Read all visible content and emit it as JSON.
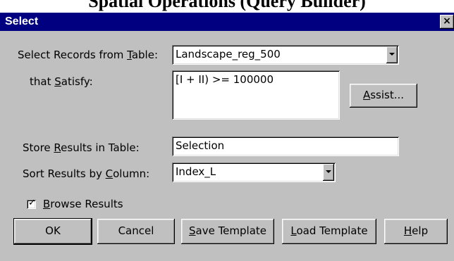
{
  "page_top_text": "Spatial Operations (Query Builder)",
  "window": {
    "title": "Select",
    "close_glyph": "×"
  },
  "select_from": {
    "label_pre": "Select Records from ",
    "label_key": "T",
    "label_post": "able:",
    "value": "Landscape_reg_500"
  },
  "satisfy": {
    "label_pre": "that ",
    "label_key": "S",
    "label_post": "atisfy:",
    "value": "[I + II) >= 100000"
  },
  "assist_button": {
    "label_key": "A",
    "label_post": "ssist..."
  },
  "store": {
    "label_pre": "Store ",
    "label_key": "R",
    "label_post": "esults in Table:",
    "value": "Selection"
  },
  "sort": {
    "label_pre": "Sort Results by ",
    "label_key": "C",
    "label_post": "olumn:",
    "value": "Index_L"
  },
  "browse": {
    "checked": true,
    "check_glyph": "✓",
    "label_key": "B",
    "label_post": "rowse Results"
  },
  "buttons": {
    "ok": "OK",
    "cancel": "Cancel",
    "save_key": "S",
    "save_post": "ave Template",
    "load_key": "L",
    "load_post": "oad Template",
    "help_key": "H",
    "help_post": "elp"
  }
}
